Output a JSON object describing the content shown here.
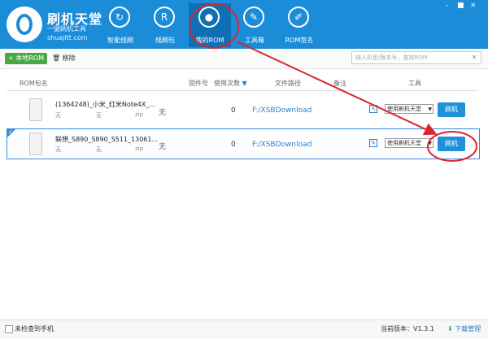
{
  "app": {
    "title": "刷机天堂",
    "subtitle": "一键刷机工具",
    "url": "shuajitt.com"
  },
  "window_controls": [
    "-",
    "■",
    "×"
  ],
  "nav": [
    {
      "label": "智能线刷",
      "icon": "phone-refresh-icon"
    },
    {
      "label": "线刷包",
      "icon": "package-r-icon"
    },
    {
      "label": "我的ROM",
      "icon": "user-icon"
    },
    {
      "label": "工具箱",
      "icon": "wrench-icon"
    },
    {
      "label": "ROM签名",
      "icon": "pen-icon"
    }
  ],
  "toolbar": {
    "local_rom": "+ 本地ROM",
    "remove": "移除",
    "search_placeholder": "输入机型/版本号，查找ROM"
  },
  "table": {
    "headers": [
      "ROM包名",
      "固件号",
      "使用次数",
      "文件路径",
      "备注",
      "工具"
    ],
    "rows": [
      {
        "name": "(1364248)_小米_红米Note4X_...",
        "sub1": "无",
        "sub2": "无",
        "sub3": "zip",
        "firmware": "无",
        "uses": "0",
        "path": "F:/XSBDownload",
        "tool": "使用刷机天堂",
        "flash": "刷机"
      },
      {
        "name": "联想_S890_S890_S511_13061...",
        "sub1": "无",
        "sub2": "无",
        "sub3": "zip",
        "firmware": "无",
        "uses": "0",
        "path": "F:/XSBDownload",
        "tool": "使用刷机天堂",
        "flash": "刷机"
      }
    ]
  },
  "status": {
    "left": "未检查到手机",
    "version": "当前版本：V1.3.1",
    "download": "下载管理"
  },
  "colors": {
    "brand": "#1a8cd8",
    "green": "#46a946",
    "annotation": "#d9262e"
  }
}
